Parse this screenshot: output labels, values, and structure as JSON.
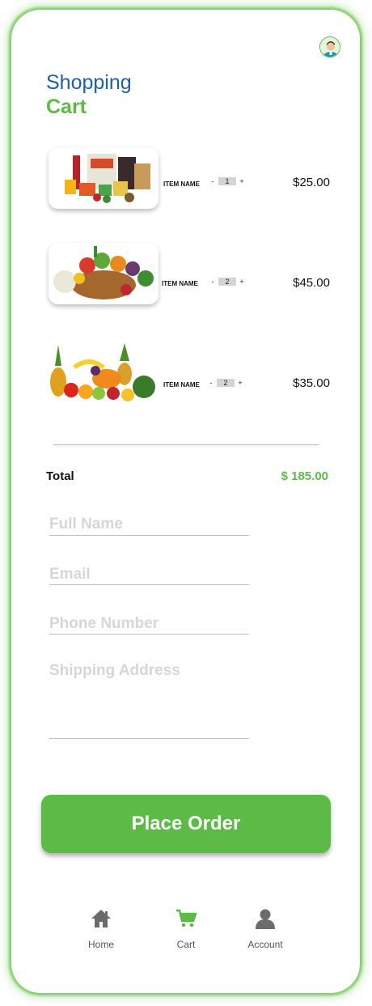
{
  "header": {
    "title_line1": "Shopping",
    "title_line2": "Cart",
    "avatar_icon": "user-avatar-icon"
  },
  "cart": {
    "items": [
      {
        "name": "ITEM NAME",
        "quantity": "1",
        "price": "$25.00",
        "image": "groceries-image",
        "minus": "-",
        "plus": "+"
      },
      {
        "name": "ITEM NAME",
        "quantity": "2",
        "price": "$45.00",
        "image": "vegetable-basket-image",
        "minus": "-",
        "plus": "+"
      },
      {
        "name": "ITEM NAME",
        "quantity": "2",
        "price": "$35.00",
        "image": "fruit-assortment-image",
        "minus": "-",
        "plus": "+"
      }
    ],
    "total_label": "Total",
    "total_value": "$ 185.00"
  },
  "form": {
    "full_name": "Full Name",
    "email": "Email",
    "phone": "Phone Number",
    "address": "Shipping Address"
  },
  "actions": {
    "place_order": "Place Order"
  },
  "nav": {
    "items": [
      {
        "label": "Home",
        "icon": "home-icon",
        "active": false
      },
      {
        "label": "Cart",
        "icon": "cart-icon",
        "active": true
      },
      {
        "label": "Account",
        "icon": "account-icon",
        "active": false
      }
    ]
  },
  "colors": {
    "accent": "#5cba47",
    "title_blue": "#1f5fa8",
    "placeholder": "#d6d6d6"
  }
}
